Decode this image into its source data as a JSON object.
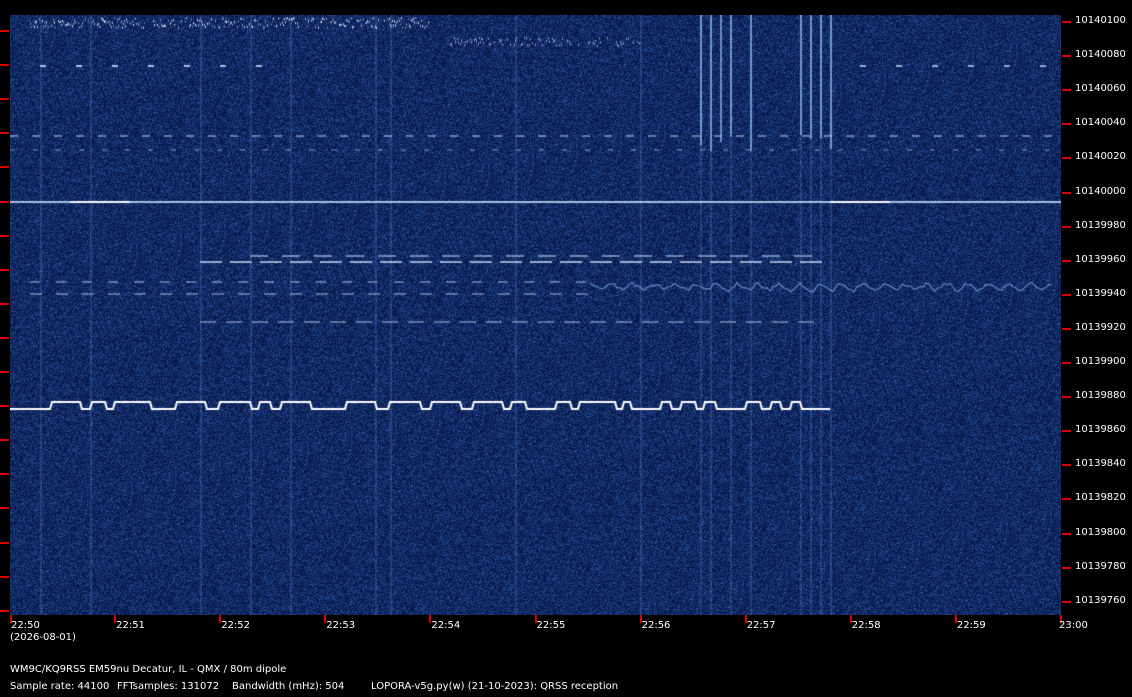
{
  "frequency_axis": {
    "labels": [
      "10140100",
      "10140080",
      "10140060",
      "10140040",
      "10140020",
      "10140000",
      "10139980",
      "10139960",
      "10139940",
      "10139920",
      "10139900",
      "10139880",
      "10139860",
      "10139840",
      "10139820",
      "10139800",
      "10139780",
      "10139760"
    ]
  },
  "time_axis": {
    "labels": [
      "22:50",
      "22:51",
      "22:52",
      "22:53",
      "22:54",
      "22:55",
      "22:56",
      "22:57",
      "22:58",
      "22:59",
      "23:00"
    ],
    "date": "(2026-08-01)"
  },
  "info": {
    "station": "WM9C/KQ9RSS EM59nu Decatur, IL - QMX / 80m dipole",
    "sample_rate": "Sample rate: 44100",
    "fft_samples": "FFTsamples: 131072",
    "bandwidth": "Bandwidth (mHz): 504",
    "software": "LOPORA-v5g.py(w) (21-10-2023): QRSS reception"
  },
  "colors": {
    "background": "#000000",
    "waterfall_base": "#0b1a5a",
    "tick_marks": "#e00000",
    "signal": "#ffffff"
  }
}
